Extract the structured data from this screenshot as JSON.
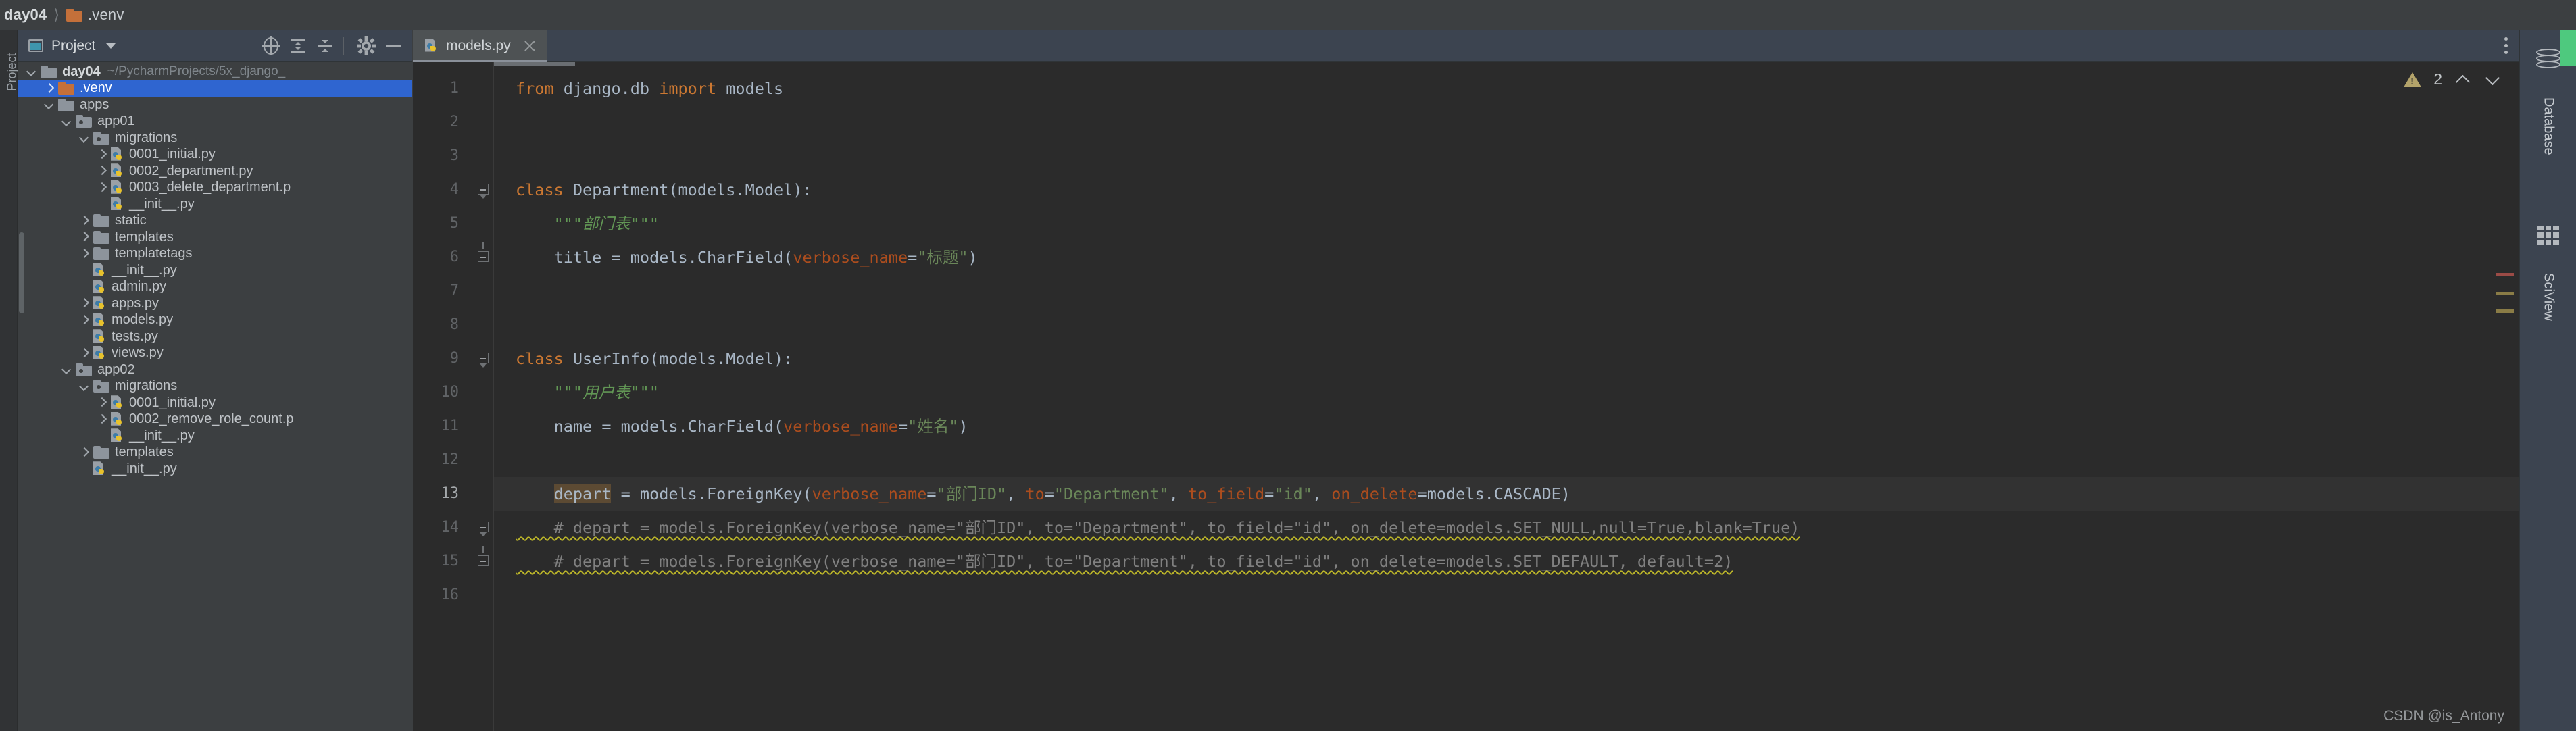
{
  "window": {
    "breadcrumb": [
      {
        "label": "day04",
        "icon": "none",
        "bold": true
      },
      {
        "label": ".venv",
        "icon": "folder-orange-icon",
        "bold": false
      }
    ]
  },
  "left_rail": {
    "label": "Project"
  },
  "project_panel": {
    "title": "Project",
    "toolbar_icons": [
      "locate-target-icon",
      "expand-all-icon",
      "collapse-all-icon",
      "settings-gear-icon",
      "hide-panel-icon"
    ],
    "tree": [
      {
        "label": "day04",
        "suffix": "~/PycharmProjects/5x_django_",
        "indent": 0,
        "arrow": "down",
        "icon": "folder-grey-icon",
        "bold": true,
        "selected": false
      },
      {
        "label": ".venv",
        "suffix": "",
        "indent": 1,
        "arrow": "right",
        "icon": "folder-orange-icon",
        "bold": false,
        "selected": true
      },
      {
        "label": "apps",
        "suffix": "",
        "indent": 1,
        "arrow": "down",
        "icon": "folder-grey-icon",
        "bold": false,
        "selected": false
      },
      {
        "label": "app01",
        "suffix": "",
        "indent": 2,
        "arrow": "down",
        "icon": "folder-module-icon",
        "bold": false,
        "selected": false
      },
      {
        "label": "migrations",
        "suffix": "",
        "indent": 3,
        "arrow": "down",
        "icon": "folder-module-icon",
        "bold": false,
        "selected": false
      },
      {
        "label": "0001_initial.py",
        "suffix": "",
        "indent": 4,
        "arrow": "right",
        "icon": "python-file-icon",
        "bold": false,
        "selected": false
      },
      {
        "label": "0002_department.py",
        "suffix": "",
        "indent": 4,
        "arrow": "right",
        "icon": "python-file-icon",
        "bold": false,
        "selected": false
      },
      {
        "label": "0003_delete_department.p",
        "suffix": "",
        "indent": 4,
        "arrow": "right",
        "icon": "python-file-icon",
        "bold": false,
        "selected": false
      },
      {
        "label": "__init__.py",
        "suffix": "",
        "indent": 4,
        "arrow": "none",
        "icon": "python-file-icon",
        "bold": false,
        "selected": false
      },
      {
        "label": "static",
        "suffix": "",
        "indent": 3,
        "arrow": "right",
        "icon": "folder-grey-icon",
        "bold": false,
        "selected": false
      },
      {
        "label": "templates",
        "suffix": "",
        "indent": 3,
        "arrow": "right",
        "icon": "folder-grey-icon",
        "bold": false,
        "selected": false
      },
      {
        "label": "templatetags",
        "suffix": "",
        "indent": 3,
        "arrow": "right",
        "icon": "folder-grey-icon",
        "bold": false,
        "selected": false
      },
      {
        "label": "__init__.py",
        "suffix": "",
        "indent": 3,
        "arrow": "none",
        "icon": "python-file-icon",
        "bold": false,
        "selected": false
      },
      {
        "label": "admin.py",
        "suffix": "",
        "indent": 3,
        "arrow": "none",
        "icon": "python-file-icon",
        "bold": false,
        "selected": false
      },
      {
        "label": "apps.py",
        "suffix": "",
        "indent": 3,
        "arrow": "right",
        "icon": "python-file-icon",
        "bold": false,
        "selected": false
      },
      {
        "label": "models.py",
        "suffix": "",
        "indent": 3,
        "arrow": "right",
        "icon": "python-file-icon",
        "bold": false,
        "selected": false
      },
      {
        "label": "tests.py",
        "suffix": "",
        "indent": 3,
        "arrow": "none",
        "icon": "python-file-icon",
        "bold": false,
        "selected": false
      },
      {
        "label": "views.py",
        "suffix": "",
        "indent": 3,
        "arrow": "right",
        "icon": "python-file-icon",
        "bold": false,
        "selected": false
      },
      {
        "label": "app02",
        "suffix": "",
        "indent": 2,
        "arrow": "down",
        "icon": "folder-module-icon",
        "bold": false,
        "selected": false
      },
      {
        "label": "migrations",
        "suffix": "",
        "indent": 3,
        "arrow": "down",
        "icon": "folder-module-icon",
        "bold": false,
        "selected": false
      },
      {
        "label": "0001_initial.py",
        "suffix": "",
        "indent": 4,
        "arrow": "right",
        "icon": "python-file-icon",
        "bold": false,
        "selected": false
      },
      {
        "label": "0002_remove_role_count.p",
        "suffix": "",
        "indent": 4,
        "arrow": "right",
        "icon": "python-file-icon",
        "bold": false,
        "selected": false
      },
      {
        "label": "__init__.py",
        "suffix": "",
        "indent": 4,
        "arrow": "none",
        "icon": "python-file-icon",
        "bold": false,
        "selected": false
      },
      {
        "label": "templates",
        "suffix": "",
        "indent": 3,
        "arrow": "right",
        "icon": "folder-grey-icon",
        "bold": false,
        "selected": false
      },
      {
        "label": "__init__.py",
        "suffix": "",
        "indent": 3,
        "arrow": "none",
        "icon": "python-file-icon",
        "bold": false,
        "selected": false
      }
    ]
  },
  "editor": {
    "tab": {
      "name": "models.py",
      "icon": "python-file-icon"
    },
    "inspection": {
      "warning_count": "2"
    },
    "line_numbers": [
      "1",
      "2",
      "3",
      "4",
      "5",
      "6",
      "7",
      "8",
      "9",
      "10",
      "11",
      "12",
      "13",
      "14",
      "15",
      "16"
    ],
    "current_line": 13,
    "code": [
      {
        "n": 1,
        "segments": [
          {
            "t": "from",
            "c": "kw"
          },
          {
            "t": " django.db ",
            "c": "plain"
          },
          {
            "t": "import",
            "c": "kw"
          },
          {
            "t": " models",
            "c": "plain"
          }
        ]
      },
      {
        "n": 2,
        "segments": []
      },
      {
        "n": 3,
        "segments": []
      },
      {
        "n": 4,
        "segments": [
          {
            "t": "class",
            "c": "kw"
          },
          {
            "t": " Department(models.Model):",
            "c": "plain"
          }
        ]
      },
      {
        "n": 5,
        "segments": [
          {
            "t": "    \"\"\"部门表\"\"\"",
            "c": "doc"
          }
        ]
      },
      {
        "n": 6,
        "segments": [
          {
            "t": "    title = models.CharField(",
            "c": "plain"
          },
          {
            "t": "verbose_name",
            "c": "param"
          },
          {
            "t": "=",
            "c": "plain"
          },
          {
            "t": "\"标题\"",
            "c": "str"
          },
          {
            "t": ")",
            "c": "plain"
          }
        ]
      },
      {
        "n": 7,
        "segments": []
      },
      {
        "n": 8,
        "segments": []
      },
      {
        "n": 9,
        "segments": [
          {
            "t": "class",
            "c": "kw"
          },
          {
            "t": " UserInfo(models.Model):",
            "c": "plain"
          }
        ]
      },
      {
        "n": 10,
        "segments": [
          {
            "t": "    \"\"\"用户表\"\"\"",
            "c": "doc"
          }
        ]
      },
      {
        "n": 11,
        "segments": [
          {
            "t": "    name = models.CharField(",
            "c": "plain"
          },
          {
            "t": "verbose_name",
            "c": "param"
          },
          {
            "t": "=",
            "c": "plain"
          },
          {
            "t": "\"姓名\"",
            "c": "str"
          },
          {
            "t": ")",
            "c": "plain"
          }
        ]
      },
      {
        "n": 12,
        "segments": []
      },
      {
        "n": 13,
        "segments": [
          {
            "t": "    ",
            "c": "plain"
          },
          {
            "t": "depart",
            "c": "selword"
          },
          {
            "t": " = models.ForeignKey(",
            "c": "plain"
          },
          {
            "t": "verbose_name",
            "c": "param"
          },
          {
            "t": "=",
            "c": "plain"
          },
          {
            "t": "\"部门ID\"",
            "c": "str"
          },
          {
            "t": ", ",
            "c": "plain"
          },
          {
            "t": "to",
            "c": "param"
          },
          {
            "t": "=",
            "c": "plain"
          },
          {
            "t": "\"Department\"",
            "c": "str"
          },
          {
            "t": ", ",
            "c": "plain"
          },
          {
            "t": "to_field",
            "c": "param"
          },
          {
            "t": "=",
            "c": "plain"
          },
          {
            "t": "\"id\"",
            "c": "str"
          },
          {
            "t": ", ",
            "c": "plain"
          },
          {
            "t": "on_delete",
            "c": "param"
          },
          {
            "t": "=",
            "c": "plain"
          },
          {
            "t": "models.CASCADE)",
            "c": "plain"
          }
        ]
      },
      {
        "n": 14,
        "segments": [
          {
            "t": "    # depart = models.ForeignKey(verbose_name=\"部门ID\", to=\"Department\", to_field=\"id\", on_delete=models.SET_NULL,null=True,blank=True)",
            "c": "comment-wavy"
          }
        ]
      },
      {
        "n": 15,
        "segments": [
          {
            "t": "    # depart = models.ForeignKey(verbose_name=\"部门ID\", to=\"Department\", to_field=\"id\", on_delete=models.SET_DEFAULT, default=2)",
            "c": "comment-wavy"
          }
        ]
      },
      {
        "n": 16,
        "segments": []
      }
    ]
  },
  "right_rail": {
    "items": [
      {
        "label": "Database",
        "icon": "database-icon"
      },
      {
        "label": "SciView",
        "icon": "grid-icon"
      }
    ]
  },
  "watermark": "CSDN @is_Antony"
}
